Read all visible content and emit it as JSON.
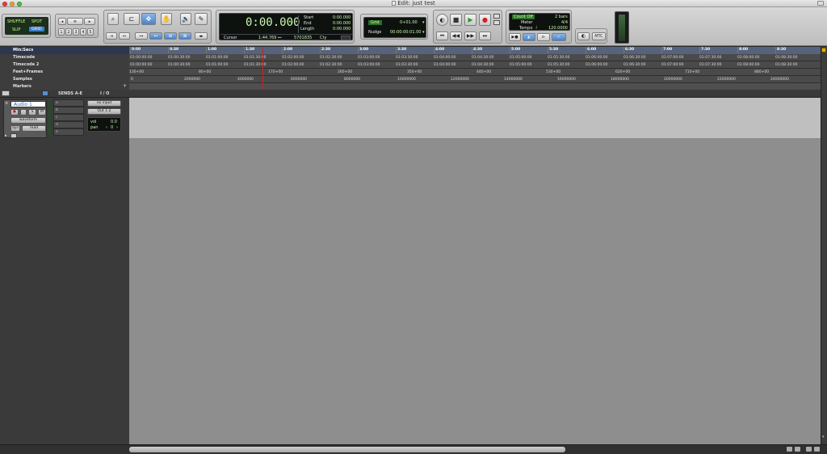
{
  "window": {
    "title": "Edit: just test"
  },
  "edit_modes": [
    "SHUFFLE",
    "SPOT",
    "SLIP",
    "GRID"
  ],
  "zoom_presets": [
    "1",
    "2",
    "3",
    "4",
    "5"
  ],
  "counter": {
    "main": "0:00.000",
    "start_label": "Start",
    "start_value": "0:00.000",
    "end_label": "End",
    "end_value": "0:00.000",
    "length_label": "Length",
    "length_value": "0:00.000",
    "cursor_label": "Cursor",
    "cursor_value": "1:44.769",
    "samples_value": "5701835",
    "cursor_unit": "Cty"
  },
  "grid_nudge": {
    "grid_label": "Grid",
    "grid_value": "0+01.00",
    "nudge_label": "Nudge",
    "nudge_value": "00:00:00:01.00"
  },
  "midi_tempo": {
    "count_off": "Count Off",
    "bars": "2 bars",
    "meter_label": "Meter",
    "meter_value": "4/4",
    "tempo_label": "Tempo",
    "tempo_value": "120.0000"
  },
  "mtc_label": "MTC",
  "rulers": {
    "minsecs": {
      "label": "Min:Secs",
      "ticks": [
        "0:00",
        "0:30",
        "1:00",
        "1:30",
        "2:00",
        "2:30",
        "3:00",
        "3:30",
        "4:00",
        "4:30",
        "5:00",
        "5:30",
        "6:00",
        "6:30",
        "7:00",
        "7:30",
        "8:00",
        "8:30"
      ]
    },
    "timecode": {
      "label": "Timecode",
      "ticks": [
        "01:00:00:00",
        "01:00:30:00",
        "01:01:00:00",
        "01:01:30:00",
        "01:02:00:00",
        "01:02:30:00",
        "01:03:00:00",
        "01:03:30:00",
        "01:04:00:00",
        "01:04:30:00",
        "01:05:00:00",
        "01:05:30:00",
        "01:06:00:00",
        "01:06:30:00",
        "01:07:00:00",
        "01:07:30:00",
        "01:08:00:00",
        "01:08:30:00"
      ]
    },
    "timecode2": {
      "label": "Timecode 2",
      "ticks": [
        "01:00:00:00",
        "01:00:30:00",
        "01:01:00:00",
        "01:01:30:00",
        "01:02:00:00",
        "01:02:30:00",
        "01:03:00:00",
        "01:03:30:00",
        "01:04:00:00",
        "01:04:30:00",
        "01:05:00:00",
        "01:05:30:00",
        "01:06:00:00",
        "01:06:30:00",
        "01:07:00:00",
        "01:07:30:00",
        "01:08:00:00",
        "01:08:30:00"
      ]
    },
    "feet_frames": {
      "label": "Feet+Frames",
      "ticks": [
        "130+00",
        "80+00",
        "170+00",
        "260+00",
        "350+00",
        "440+00",
        "530+00",
        "620+00",
        "710+00",
        "880+00"
      ]
    },
    "samples": {
      "label": "Samples",
      "ticks": [
        "0",
        "2000000",
        "4000000",
        "6000000",
        "8000000",
        "10000000",
        "12000000",
        "14000000",
        "16000000",
        "18000000",
        "20000000",
        "22000000",
        "24000000"
      ]
    },
    "markers": {
      "label": "Markers"
    }
  },
  "track_header": {
    "sends": "SENDS A-E",
    "io": "I / O"
  },
  "track": {
    "name": "Audio 1",
    "solo": "S",
    "mute": "M",
    "view": "waveform",
    "automation_label": "dyn",
    "automation_mode": "read",
    "input": "no input",
    "output": "Out 1-2",
    "vol_label": "vol",
    "vol_value": "0.0",
    "pan_label": "pan",
    "pan_value": "0",
    "send_slots": [
      "a",
      "b",
      "c",
      "d",
      "e"
    ]
  }
}
